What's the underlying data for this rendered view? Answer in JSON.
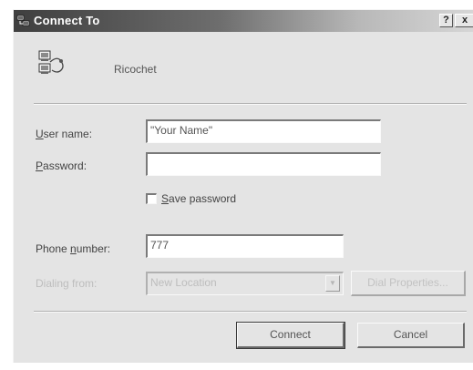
{
  "window": {
    "title": "Connect To",
    "help_glyph": "?",
    "close_glyph": "x"
  },
  "connection": {
    "name": "Ricochet",
    "icon": "dialup-computers-icon"
  },
  "form": {
    "username_label_key": "U",
    "username_label_rest": "ser name:",
    "username_value": "\"Your Name\"",
    "password_label_key": "P",
    "password_label_rest": "assword:",
    "password_value": "",
    "save_password_key": "S",
    "save_password_rest": "ave password",
    "save_password_checked": false,
    "phone_label_pre": "Phone ",
    "phone_label_key": "n",
    "phone_label_rest": "umber:",
    "phone_value": "777",
    "dialing_from_label": "Dialing from:",
    "dialing_from_value": "New Location",
    "dial_properties_label": "Dial Properties..."
  },
  "buttons": {
    "connect": "Connect",
    "cancel": "Cancel"
  },
  "colors": {
    "title_start": "#3f3f3f",
    "dialog_bg": "#e4e4e4"
  }
}
